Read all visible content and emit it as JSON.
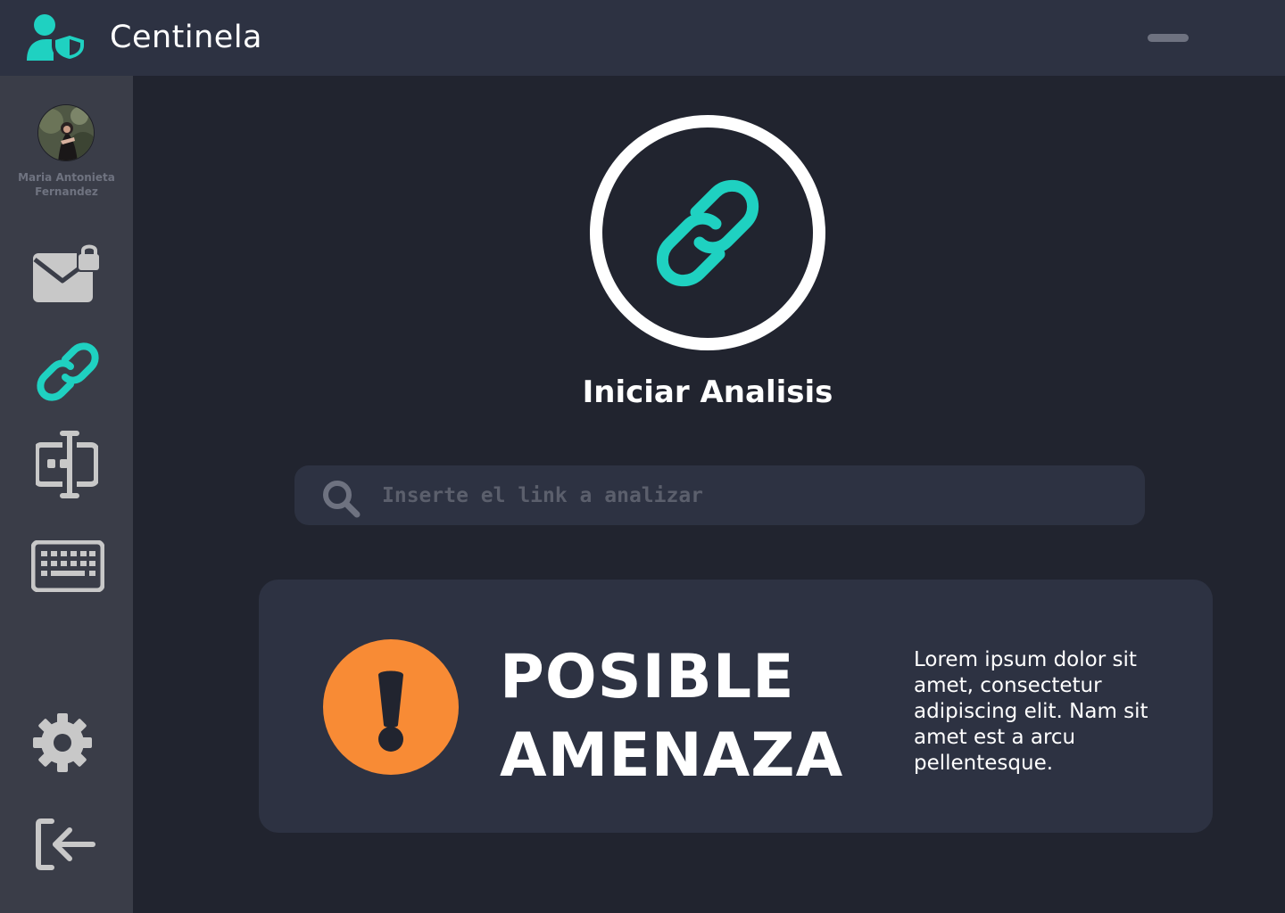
{
  "app": {
    "title": "Centinela",
    "accent_color": "#1fd1c1",
    "warning_color": "#f88b35"
  },
  "sidebar": {
    "user_name": "Maria Antonieta Fernandez",
    "items": [
      {
        "icon": "locked-mail-icon",
        "active": false
      },
      {
        "icon": "link-icon",
        "active": true
      },
      {
        "icon": "text-cursor-field-icon",
        "active": false
      },
      {
        "icon": "keyboard-icon",
        "active": false
      }
    ],
    "bottom_items": [
      {
        "icon": "gear-icon"
      },
      {
        "icon": "logout-icon"
      }
    ]
  },
  "main": {
    "action_label": "Iniciar Analisis",
    "search": {
      "placeholder": "Inserte el link a analizar",
      "value": ""
    },
    "result": {
      "status_line1": "POSIBLE",
      "status_line2": "AMENAZA",
      "description": "Lorem ipsum dolor sit amet, consectetur adipiscing elit. Nam sit amet est a arcu pellentesque."
    }
  }
}
